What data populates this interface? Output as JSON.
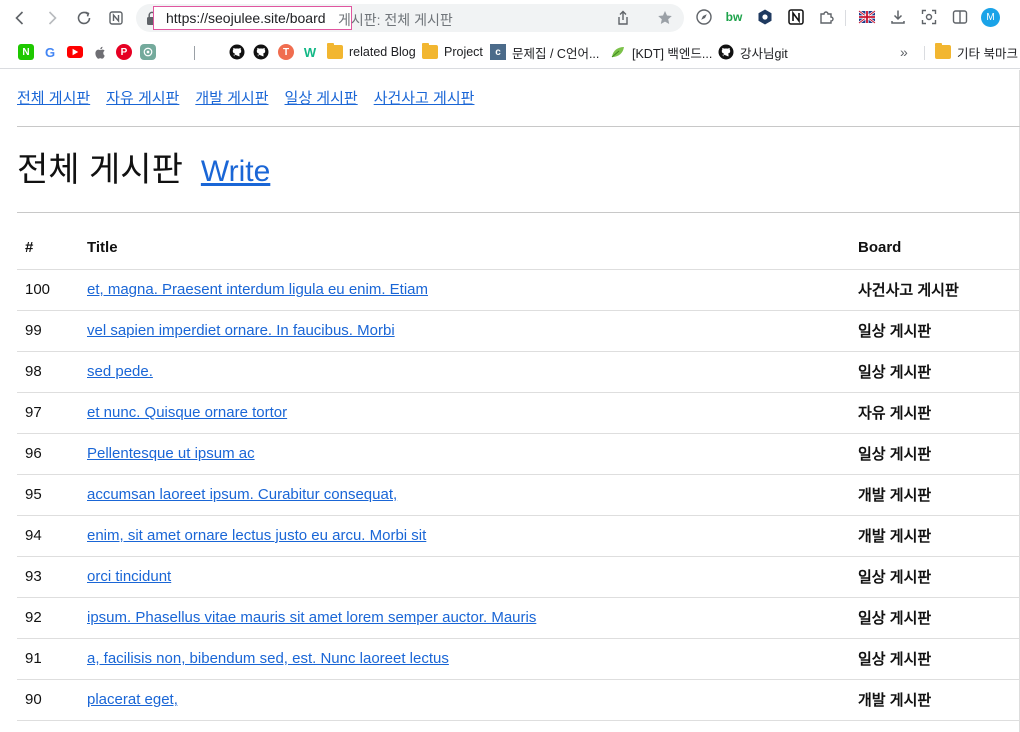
{
  "browser": {
    "url": "https://seojulee.site/board",
    "page_title": "게시판: 전체 게시판",
    "profile_initial": "M",
    "extensions": [
      "compass-icon",
      "bw-icon",
      "hexagon-icon",
      "notion-icon",
      "puzzle-icon",
      "uk-flag-icon",
      "download-icon",
      "screenshot-icon",
      "sidebar-icon"
    ]
  },
  "bookmarks": {
    "items": [
      {
        "label": "related Blog",
        "icon": "folder-icon"
      },
      {
        "label": "Project",
        "icon": "folder-icon"
      },
      {
        "label": "문제집 / C언어...",
        "icon": "c-badge-icon"
      },
      {
        "label": "[KDT] 백엔드...",
        "icon": "leaf-icon"
      },
      {
        "label": "강사님git",
        "icon": "github-icon"
      }
    ],
    "overflow": "»",
    "other": "기타 북마크"
  },
  "nav": {
    "links": [
      "전체 게시판",
      "자유 게시판",
      "개발 게시판",
      "일상 게시판",
      "사건사고 게시판"
    ]
  },
  "heading": {
    "title": "전체 게시판",
    "write": "Write"
  },
  "table": {
    "headers": {
      "num": "#",
      "title": "Title",
      "board": "Board"
    },
    "rows": [
      {
        "num": "100",
        "title": "et, magna. Praesent interdum ligula eu enim. Etiam",
        "board": "사건사고 게시판"
      },
      {
        "num": "99",
        "title": "vel sapien imperdiet ornare. In faucibus. Morbi",
        "board": "일상 게시판"
      },
      {
        "num": "98",
        "title": "sed pede.",
        "board": "일상 게시판"
      },
      {
        "num": "97",
        "title": "et nunc. Quisque ornare tortor",
        "board": "자유 게시판"
      },
      {
        "num": "96",
        "title": "Pellentesque ut ipsum ac",
        "board": "일상 게시판"
      },
      {
        "num": "95",
        "title": "accumsan laoreet ipsum. Curabitur consequat,",
        "board": "개발 게시판"
      },
      {
        "num": "94",
        "title": "enim, sit amet ornare lectus justo eu arcu. Morbi sit",
        "board": "개발 게시판"
      },
      {
        "num": "93",
        "title": "orci tincidunt",
        "board": "일상 게시판"
      },
      {
        "num": "92",
        "title": "ipsum. Phasellus vitae mauris sit amet lorem semper auctor. Mauris",
        "board": "일상 게시판"
      },
      {
        "num": "91",
        "title": "a, facilisis non, bibendum sed, est. Nunc laoreet lectus",
        "board": "일상 게시판"
      },
      {
        "num": "90",
        "title": "placerat eget,",
        "board": "개발 게시판"
      }
    ]
  }
}
